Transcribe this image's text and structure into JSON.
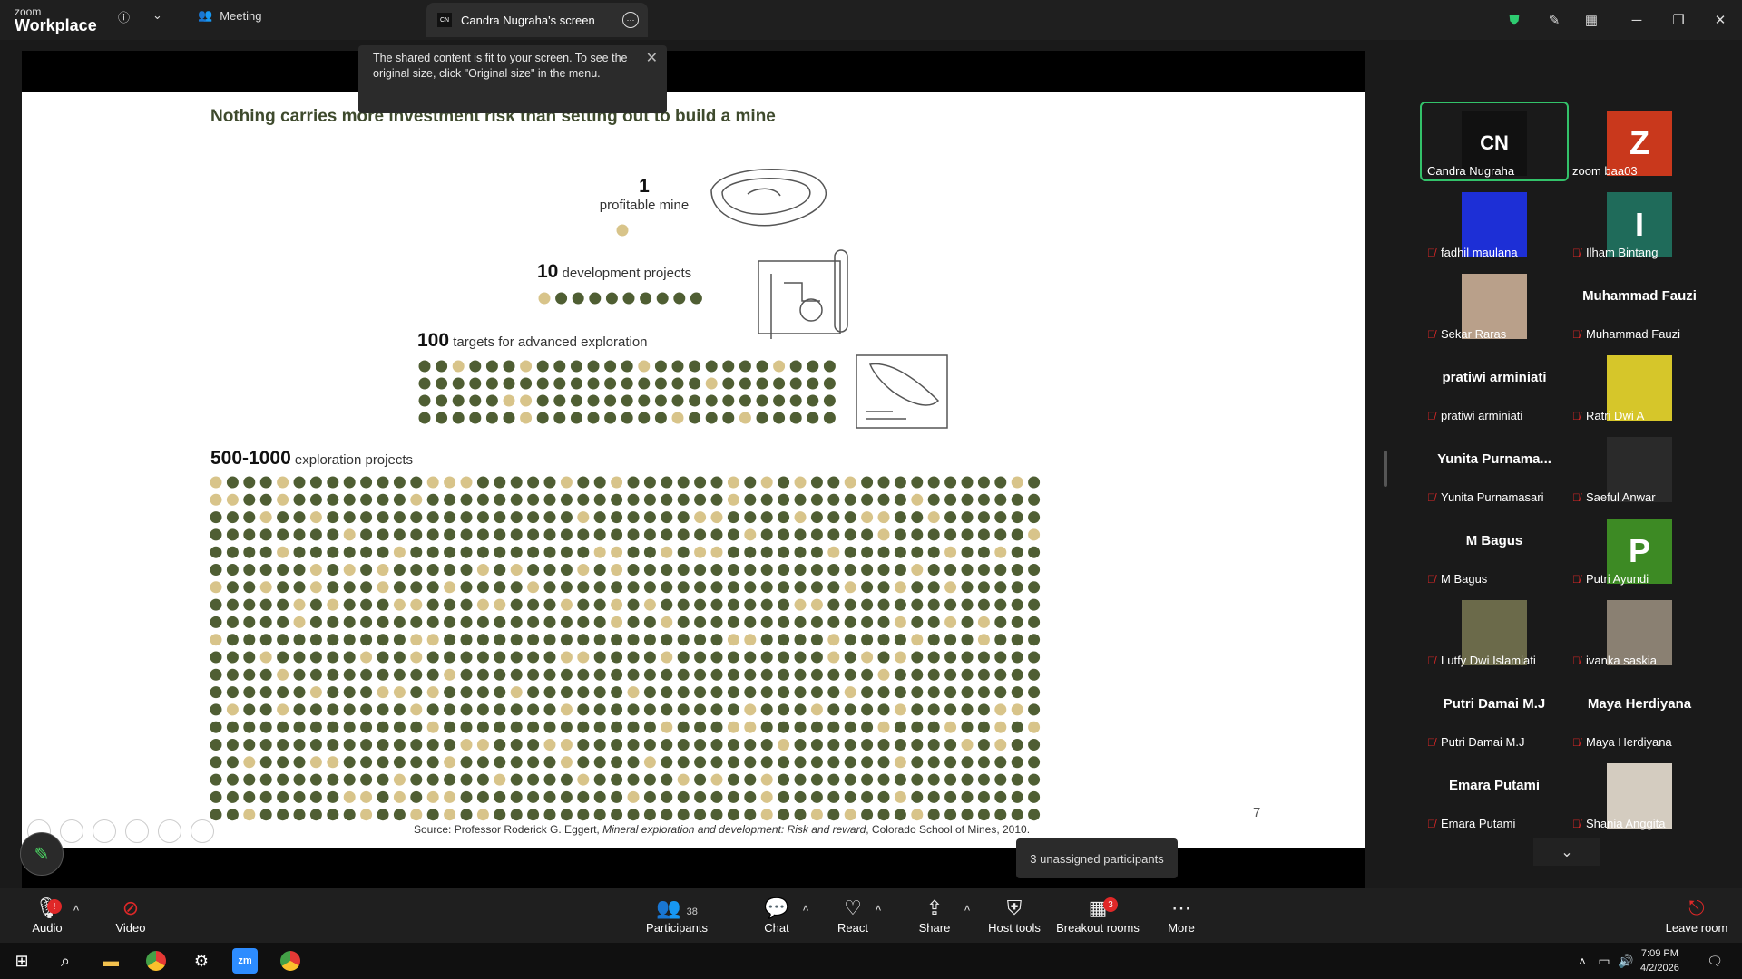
{
  "app": {
    "brand_small": "zoom",
    "brand_big": "Workplace",
    "meeting_label": "Meeting",
    "screen_tab": "Candra Nugraha's screen",
    "screen_tab_initials": "CN"
  },
  "tooltip": "The shared content is fit to your screen. To see the original size, click \"Original size\" in the menu.",
  "slide": {
    "title": "Nothing carries more investment risk than setting out to build a mine",
    "tier1_num": "1",
    "tier1_text": "profitable mine",
    "tier2_num": "10",
    "tier2_text": "development projects",
    "tier3_num": "100",
    "tier3_text": "targets for advanced exploration",
    "tier4_num": "500-1000",
    "tier4_text": "exploration projects",
    "source_prefix": "Source: Professor Roderick G. Eggert, ",
    "source_italic": "Mineral exploration and development: Risk and reward",
    "source_suffix": ", Colorado School of Mines, 2010.",
    "page_number": "7",
    "dot_green": "#4f5e33",
    "dot_tan": "#d8c48a"
  },
  "participants": [
    {
      "tile": "CN",
      "name": "Candra Nugraha",
      "type": "initials",
      "bg": "#111111",
      "muted": false
    },
    {
      "tile": "Z",
      "name": "zoom baa03",
      "type": "initials",
      "bg": "#c9381c",
      "muted": false
    },
    {
      "tile": "",
      "name": "fadhil maulana",
      "type": "photo",
      "bg": "#1d2fd6",
      "muted": true
    },
    {
      "tile": "I",
      "name": "Ilham Bintang",
      "type": "initials",
      "bg": "#1f6b5a",
      "muted": true
    },
    {
      "tile": "",
      "name": "Sekar Raras",
      "type": "photo",
      "bg": "#b9a08a",
      "muted": true
    },
    {
      "tile": "Muhammad Fauzi",
      "name": "Muhammad Fauzi",
      "type": "name",
      "bg": "",
      "muted": true
    },
    {
      "tile": "pratiwi arminiati",
      "name": "pratiwi arminiati",
      "type": "name",
      "bg": "",
      "muted": true
    },
    {
      "tile": "",
      "name": "Ratri Dwi A",
      "type": "photo",
      "bg": "#d6c62a",
      "muted": true
    },
    {
      "tile": "Yunita  Purnama...",
      "name": "Yunita Purnamasari",
      "type": "name",
      "bg": "",
      "muted": true
    },
    {
      "tile": "",
      "name": "Saeful Anwar",
      "type": "photo",
      "bg": "#2a2a2a",
      "muted": true
    },
    {
      "tile": "M Bagus",
      "name": "M Bagus",
      "type": "name",
      "bg": "",
      "muted": true
    },
    {
      "tile": "P",
      "name": "Putri Ayundi",
      "type": "initials",
      "bg": "#3d8a24",
      "muted": true
    },
    {
      "tile": "",
      "name": "Lutfy Dwi Islamiati",
      "type": "photo",
      "bg": "#6b6a4a",
      "muted": true
    },
    {
      "tile": "",
      "name": "ivanka saskia",
      "type": "photo",
      "bg": "#8a8072",
      "muted": true
    },
    {
      "tile": "Putri Damai M.J",
      "name": "Putri Damai M.J",
      "type": "name",
      "bg": "",
      "muted": true
    },
    {
      "tile": "Maya Herdiyana",
      "name": "Maya Herdiyana",
      "type": "name",
      "bg": "",
      "muted": true
    },
    {
      "tile": "Emara Putami",
      "name": "Emara Putami",
      "type": "name",
      "bg": "",
      "muted": true
    },
    {
      "tile": "",
      "name": "Shania Anggita",
      "type": "photo",
      "bg": "#d4ccc0",
      "muted": true
    }
  ],
  "unassigned": "3 unassigned participants",
  "toolbar": {
    "audio": "Audio",
    "video": "Video",
    "participants": "Participants",
    "participants_count": "38",
    "chat": "Chat",
    "react": "React",
    "share": "Share",
    "host_tools": "Host tools",
    "breakout": "Breakout rooms",
    "breakout_badge": "3",
    "more": "More",
    "leave": "Leave room"
  },
  "taskbar": {
    "time": "7:09 PM",
    "date": "4/2/2026"
  }
}
